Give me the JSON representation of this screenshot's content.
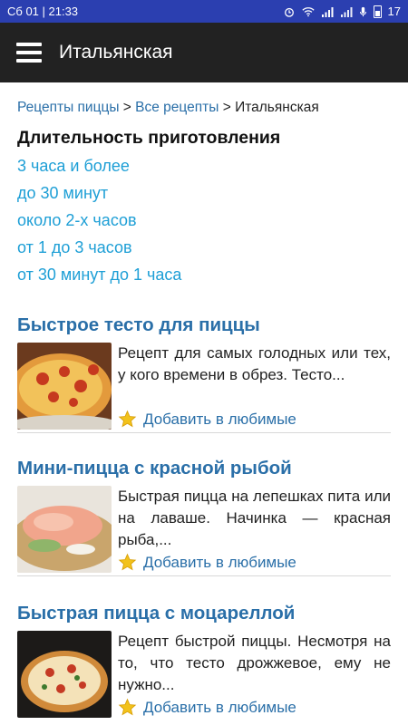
{
  "status_bar": {
    "time": "Сб 01 | 21:33",
    "battery": "17"
  },
  "app_bar": {
    "title": "Итальянская",
    "menu_icon": "hamburger-menu-icon"
  },
  "breadcrumb": {
    "items": [
      "Рецепты пиццы",
      "Все рецепты"
    ],
    "current": "Итальянская",
    "separator": " > "
  },
  "filter": {
    "title": "Длительность приготовления",
    "options": [
      "3 часа и более",
      "до 30 минут",
      "около 2-х часов",
      "от 1 до 3 часов",
      "от 30 минут до 1 часа"
    ]
  },
  "recipes": [
    {
      "title": "Быстрое тесто для пиццы",
      "description": "Рецепт для самых голодных или тех, у кого времени в обрез. Тесто...",
      "favorite_label": "Добавить в любимые"
    },
    {
      "title": "Мини-пицца с красной рыбой",
      "description": "Быстрая пицца на лепешках пита или на лаваше. Начинка — красная рыба,...",
      "favorite_label": "Добавить в любимые"
    },
    {
      "title": "Быстрая пицца с моцареллой",
      "description": "Рецепт быстрой пиццы. Несмотря на то, что тесто дрожжевое, ему не нужно...",
      "favorite_label": "Добавить в любимые"
    }
  ],
  "colors": {
    "status_bar": "#2b3fb0",
    "app_bar": "#222222",
    "link": "#2a6fa8",
    "filter_link": "#1e9fd6",
    "star": "#f2c21b"
  }
}
